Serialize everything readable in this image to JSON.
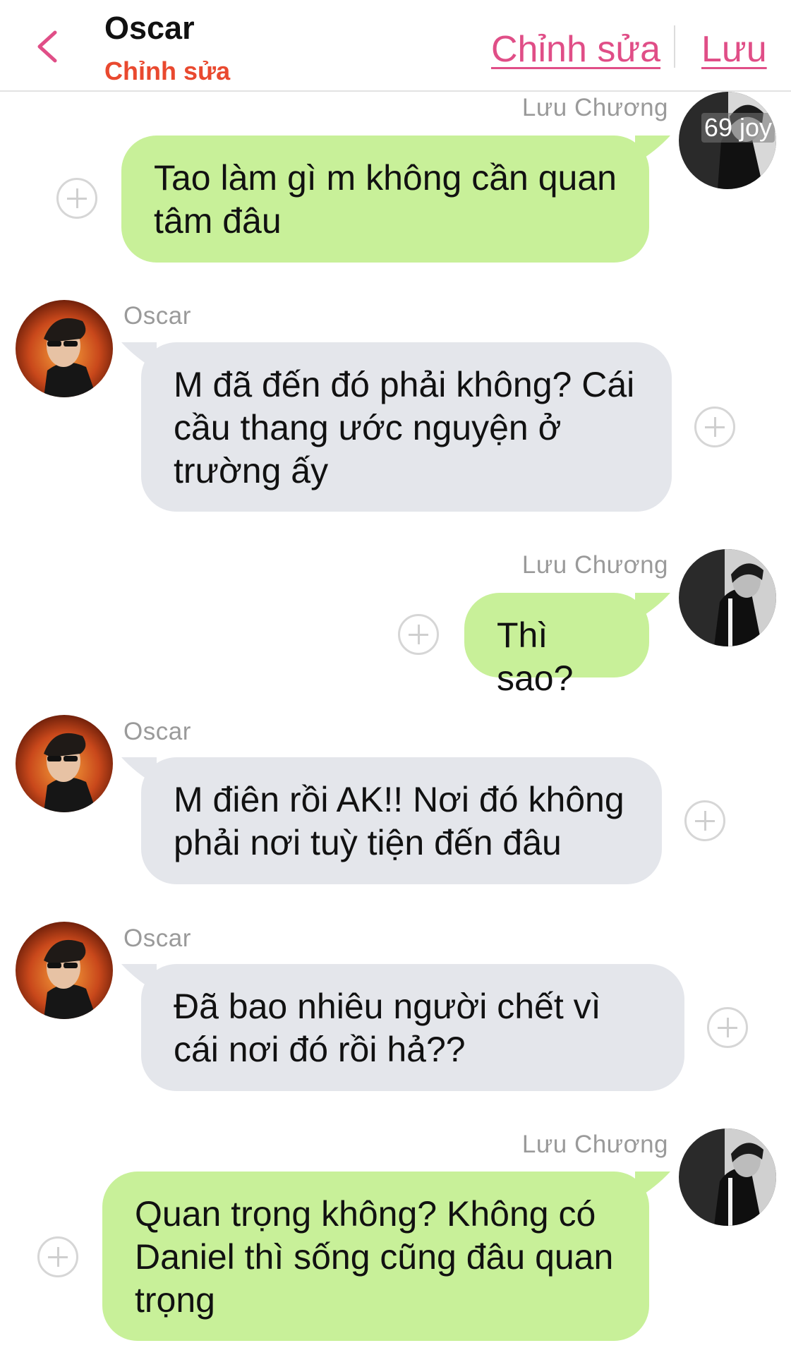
{
  "header": {
    "contact_name": "Oscar",
    "contact_subtitle": "Chỉnh sửa",
    "edit_label": "Chỉnh sửa",
    "save_label": "Lưu"
  },
  "colors": {
    "accent": "#e04e87",
    "subtitle": "#e9492f",
    "my_bubble": "#c8f099",
    "their_bubble": "#e4e6eb"
  },
  "avatar_watermark": "69 joy",
  "messages": [
    {
      "sender": "Lưu Chương",
      "side": "right",
      "text": "Tao làm gì m không cần quan tâm đâu"
    },
    {
      "sender": "Oscar",
      "side": "left",
      "text": "M đã đến đó phải không? Cái cầu thang ước nguyện ở trường ấy"
    },
    {
      "sender": "Lưu Chương",
      "side": "right",
      "text": "Thì sao?"
    },
    {
      "sender": "Oscar",
      "side": "left",
      "text": "M điên rồi AK!! Nơi đó không phải nơi tuỳ tiện đến đâu"
    },
    {
      "sender": "Oscar",
      "side": "left",
      "text": "Đã bao nhiêu người chết vì cái nơi đó rồi hả??"
    },
    {
      "sender": "Lưu Chương",
      "side": "right",
      "text": "Quan trọng không? Không có Daniel thì sống cũng đâu quan trọng"
    }
  ]
}
